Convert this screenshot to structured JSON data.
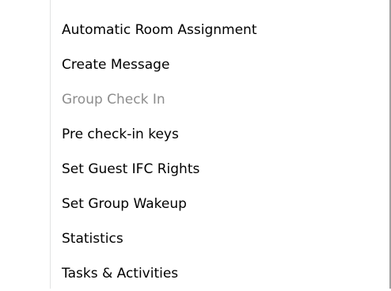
{
  "context_menu": {
    "items": [
      {
        "label": "Automatic Room Assignment",
        "enabled": true
      },
      {
        "label": "Create Message",
        "enabled": true
      },
      {
        "label": "Group Check In",
        "enabled": false
      },
      {
        "label": "Pre check-in keys",
        "enabled": true
      },
      {
        "label": "Set Guest IFC Rights",
        "enabled": true
      },
      {
        "label": "Set Group Wakeup",
        "enabled": true
      },
      {
        "label": "Statistics",
        "enabled": true
      },
      {
        "label": "Tasks & Activities",
        "enabled": true
      }
    ]
  }
}
